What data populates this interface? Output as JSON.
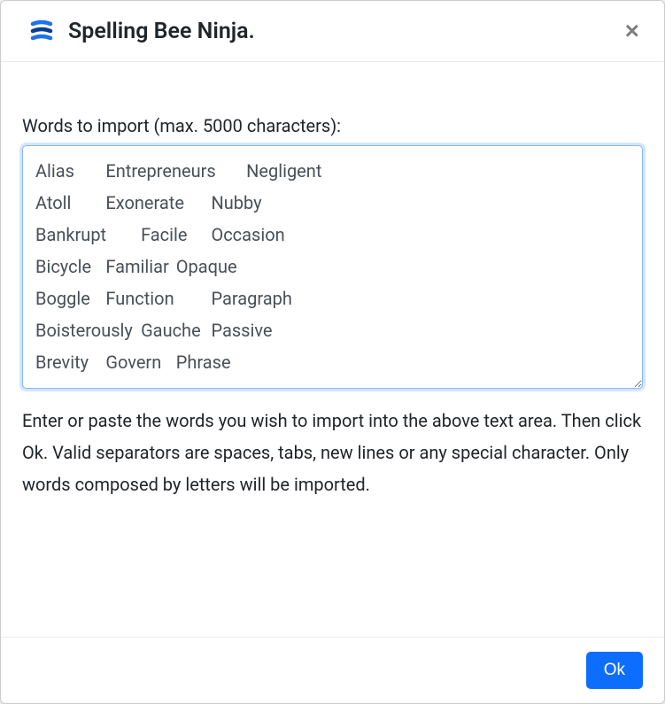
{
  "header": {
    "title": "Spelling Bee Ninja."
  },
  "form": {
    "label": "Words to import (max. 5000 characters):",
    "textarea_value": "Alias\tEntrepreneurs\tNegligent\nAtoll\tExonerate\tNubby\nBankrupt\tFacile\tOccasion\nBicycle\tFamiliar\tOpaque\nBoggle\tFunction\tParagraph\nBoisterously\tGauche\tPassive\nBrevity\tGovern\tPhrase",
    "help_text": "Enter or paste the words you wish to import into the above text area. Then click Ok. Valid separators are spaces, tabs, new lines or any special character. Only words composed by letters will be imported."
  },
  "footer": {
    "ok_label": "Ok"
  }
}
